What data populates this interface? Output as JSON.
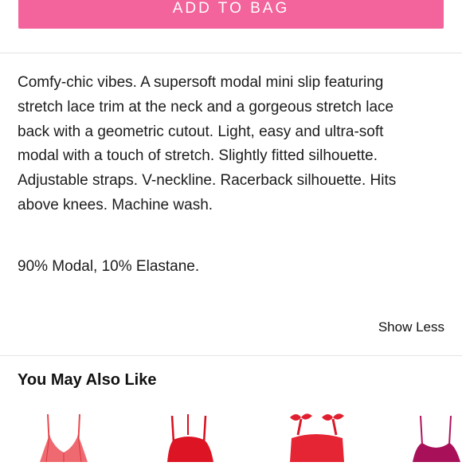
{
  "add_to_bag_label": "ADD TO BAG",
  "description": {
    "lines": [
      "Comfy-chic vibes. A supersoft modal mini slip featuring",
      "stretch lace trim at the neck and a gorgeous stretch lace",
      "back with a geometric cutout. Light, easy and ultra-soft",
      "modal with a touch of stretch. Slightly fitted silhouette.",
      "Adjustable straps. V-neckline. Racerback silhouette. Hits",
      "above knees. Machine wash."
    ],
    "composition": "90% Modal, 10% Elastane."
  },
  "show_less_label": "Show Less",
  "recommendations": {
    "title": "You May Also Like",
    "items": [
      {
        "color": "#e8484f",
        "icon": "lace-bralette-thumbnail"
      },
      {
        "color": "#d80f1f",
        "icon": "red-slip-thumbnail"
      },
      {
        "color": "#e02030",
        "icon": "satin-bow-top-thumbnail"
      },
      {
        "color": "#b0125c",
        "icon": "magenta-slip-thumbnail"
      }
    ]
  },
  "colors": {
    "accent": "#f2649b",
    "divider": "#e4e4e4"
  }
}
